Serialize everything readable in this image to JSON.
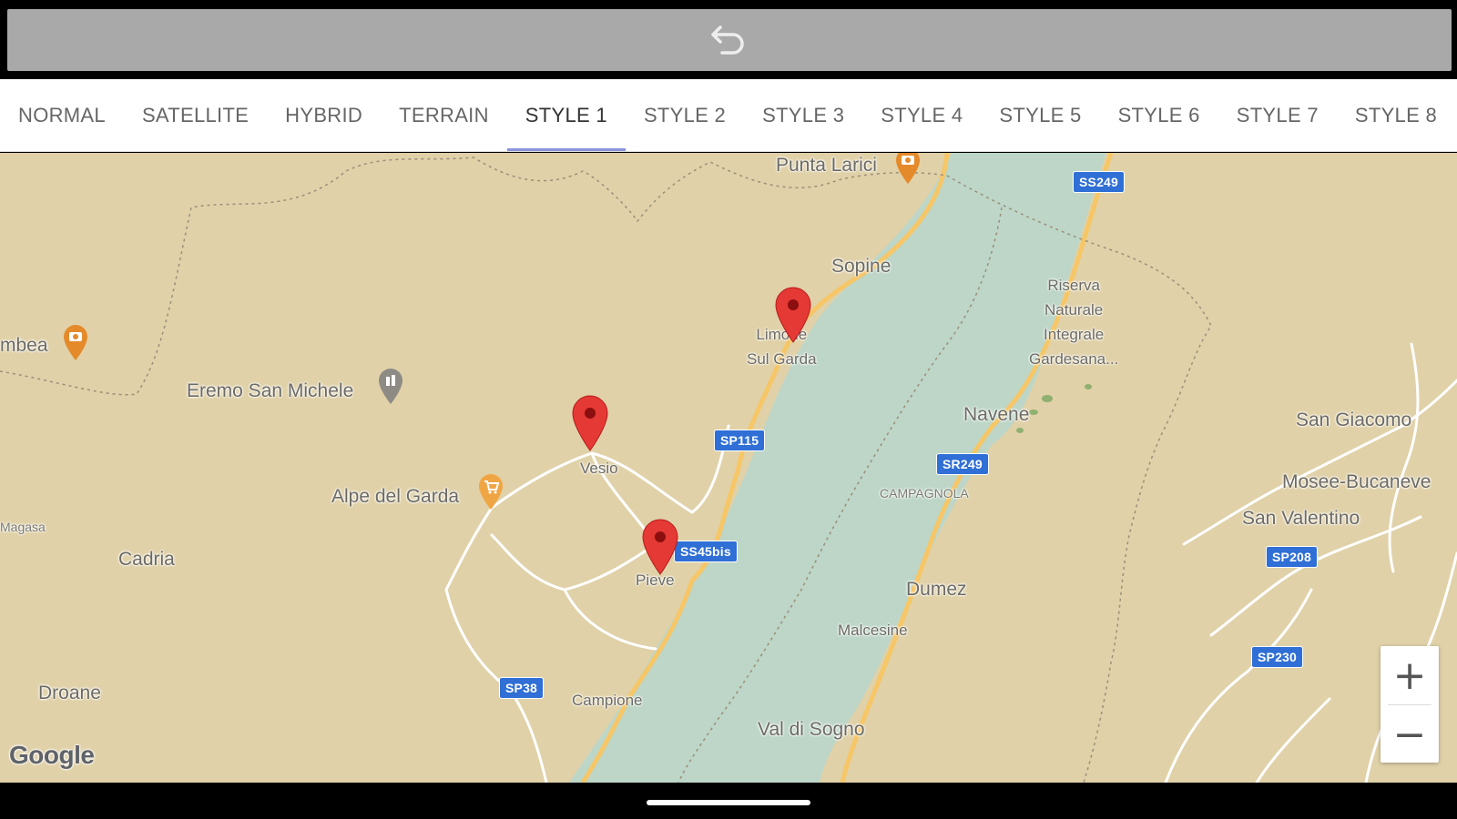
{
  "tabs": [
    {
      "label": "NORMAL"
    },
    {
      "label": "SATELLITE"
    },
    {
      "label": "HYBRID"
    },
    {
      "label": "TERRAIN"
    },
    {
      "label": "STYLE 1",
      "active": true
    },
    {
      "label": "STYLE 2"
    },
    {
      "label": "STYLE 3"
    },
    {
      "label": "STYLE 4"
    },
    {
      "label": "STYLE 5"
    },
    {
      "label": "STYLE 6"
    },
    {
      "label": "STYLE 7"
    },
    {
      "label": "STYLE 8"
    }
  ],
  "map": {
    "colors": {
      "land": "#e0d1a8",
      "water": "#bdd6c8",
      "road": "#f6c667",
      "marker": "#e53935",
      "poi": "#e58a2a"
    },
    "places": {
      "punta_larici": "Punta Larici",
      "sopine": "Sopine",
      "limone": "Limone\nSul Garda",
      "riserva": "Riserva\nNaturale\nIntegrale\nGardesana...",
      "ambea": "mbea",
      "eremo": "Eremo San Michele",
      "navene": "Navene",
      "san_giacomo": "San Giacomo",
      "vesio": "Vesio",
      "alpe": "Alpe del Garda",
      "mosee": "Mosee-Bucaneve",
      "campagnola": "CAMPAGNOLA",
      "magasa": "Magasa",
      "san_valentino": "San Valentino",
      "cadria": "Cadria",
      "pieve": "Pieve",
      "dumez": "Dumez",
      "malcesine": "Malcesine",
      "droane": "Droane",
      "campione": "Campione",
      "val_di_sogno": "Val di Sogno"
    },
    "shields": {
      "ss249": "SS249",
      "sp115": "SP115",
      "sr249": "SR249",
      "ss45bis": "SS45bis",
      "sp208": "SP208",
      "sp230": "SP230",
      "sp38": "SP38"
    },
    "attribution": "Google",
    "zoom": {
      "in": "+",
      "out": "−"
    }
  }
}
